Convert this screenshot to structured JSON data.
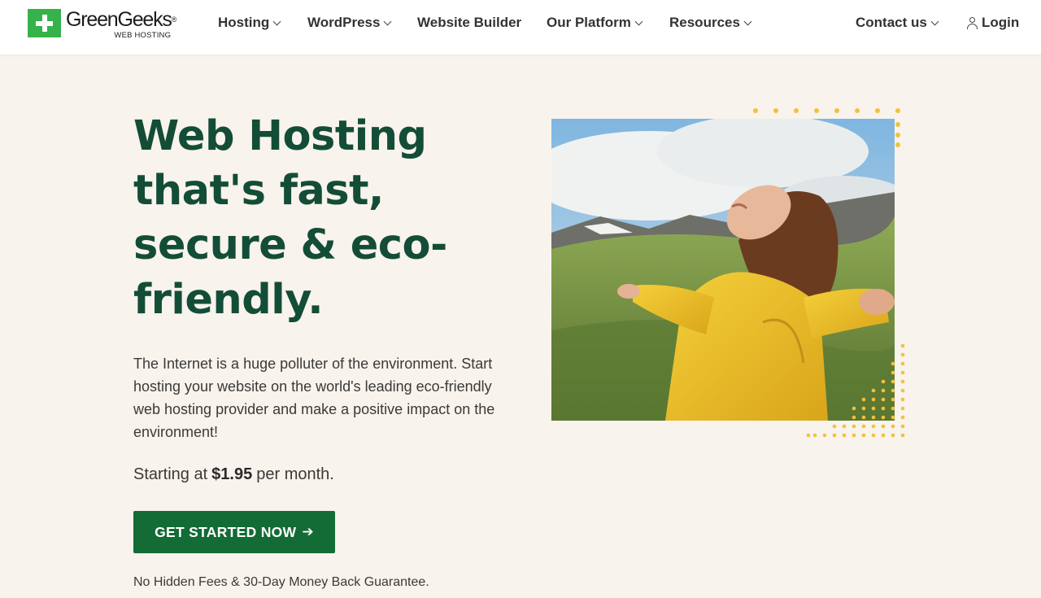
{
  "header": {
    "logo_name": "GreenGeeks",
    "logo_reg": "®",
    "logo_sub": "WEB HOSTING",
    "nav": {
      "hosting": "Hosting",
      "wordpress": "WordPress",
      "website_builder": "Website Builder",
      "our_platform": "Our Platform",
      "resources": "Resources",
      "contact_us": "Contact us",
      "login": "Login"
    }
  },
  "hero": {
    "title": "Web Hosting that's fast, secure & eco-friendly.",
    "description": "The Internet is a huge polluter of the environment. Start hosting your website on the world's leading eco-friendly web hosting provider and make a positive impact on the environment!",
    "price_prefix": "Starting at",
    "price": "$1.95",
    "price_suffix": "per month.",
    "cta_label": "GET STARTED NOW",
    "cta_icon": "arrow-right-icon",
    "guarantee": "No Hidden Fees & 30-Day Money Back Guarantee."
  },
  "colors": {
    "brand_green": "#36b24a",
    "dark_green": "#134d37",
    "button_green": "#136b35",
    "background": "#f8f3ec",
    "dot_yellow": "#f2c13d"
  }
}
